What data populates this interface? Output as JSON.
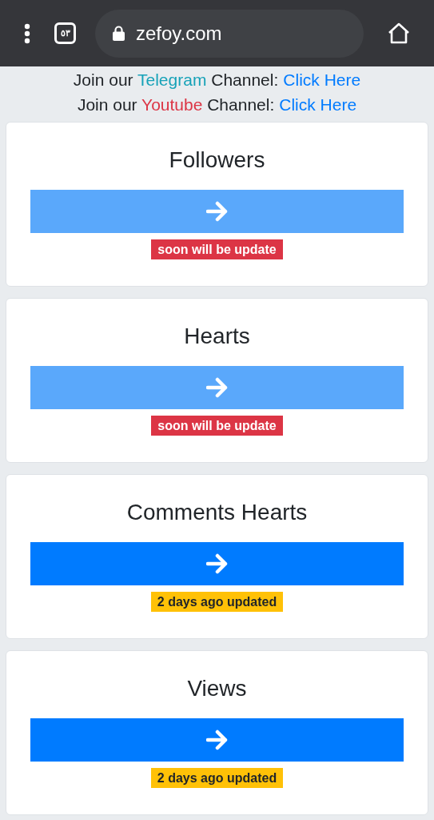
{
  "browser": {
    "tab_count": "٥٣",
    "url": "zefoy.com"
  },
  "join_lines": [
    {
      "prefix": "Join our ",
      "service": {
        "text": "Telegram",
        "color": "#17a2b8"
      },
      "suffix": " Channel: ",
      "link": "Click Here"
    },
    {
      "prefix": "Join our ",
      "service": {
        "text": "Youtube",
        "color": "#dc3545"
      },
      "suffix": " Channel: ",
      "link": "Click Here"
    }
  ],
  "cards": [
    {
      "title": "Followers",
      "disabled": true,
      "badge": {
        "kind": "danger",
        "text": "soon will be update"
      }
    },
    {
      "title": "Hearts",
      "disabled": true,
      "badge": {
        "kind": "danger",
        "text": "soon will be update"
      }
    },
    {
      "title": "Comments Hearts",
      "disabled": false,
      "badge": {
        "kind": "warning",
        "text": "2 days ago updated"
      }
    },
    {
      "title": "Views",
      "disabled": false,
      "badge": {
        "kind": "warning",
        "text": "2 days ago updated"
      }
    }
  ]
}
